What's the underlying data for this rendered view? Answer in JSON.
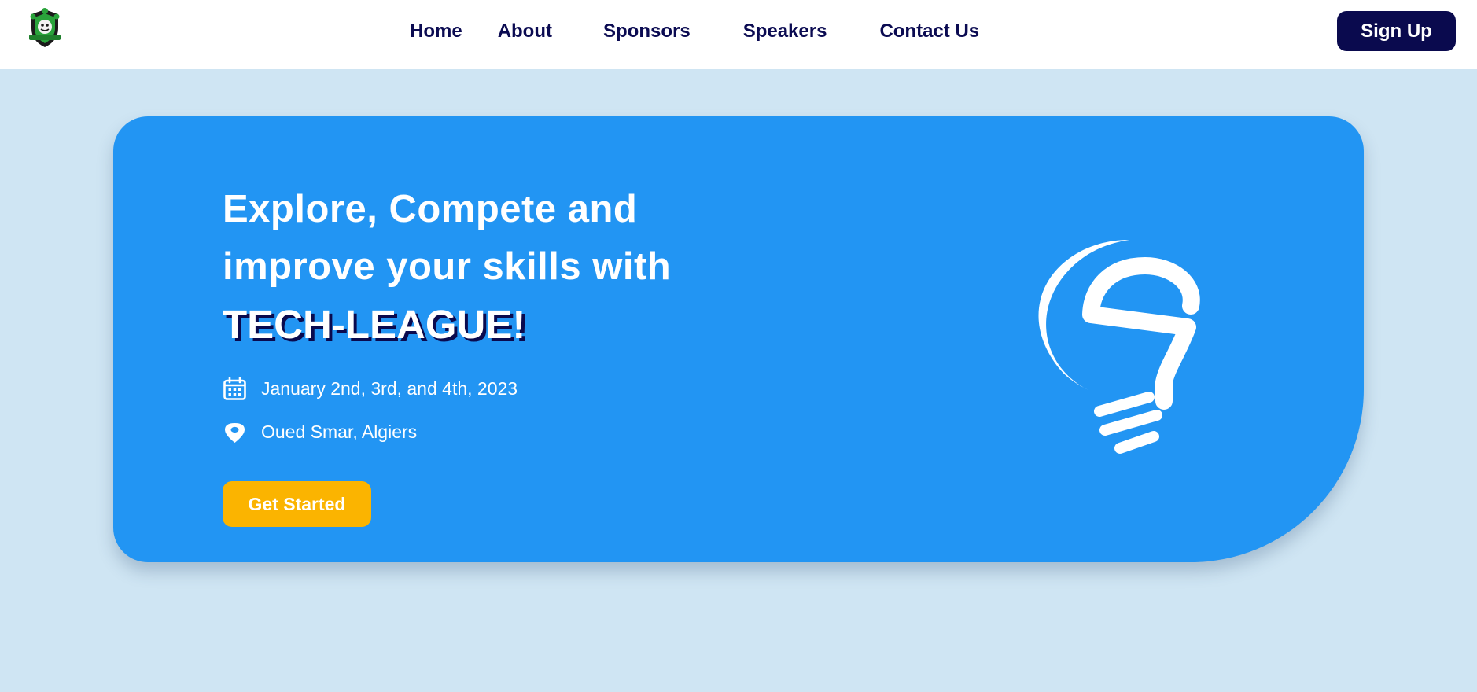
{
  "nav": {
    "logo_icon": "team-crest-logo",
    "links": [
      {
        "label": "Home"
      },
      {
        "label": "About"
      },
      {
        "label": "Sponsors"
      },
      {
        "label": "Speakers"
      },
      {
        "label": "Contact Us"
      }
    ],
    "signup_label": "Sign Up"
  },
  "hero": {
    "headline_line1": "Explore, Compete and",
    "headline_line2": "improve your skills with",
    "brand": "TECH-LEAGUE!",
    "date_icon": "calendar-icon",
    "date": "January 2nd, 3rd, and 4th, 2023",
    "location_icon": "location-pin-icon",
    "location": "Oued Smar, Algiers",
    "cta_label": "Get Started",
    "illustration": "lightbulb-icon"
  },
  "colors": {
    "page_bg": "#cfe5f3",
    "navbar_bg": "#ffffff",
    "nav_text": "#0b0b52",
    "primary_dark": "#0a0a4e",
    "hero_bg": "#2295f3",
    "cta_bg": "#fbb400",
    "text_light": "#ffffff"
  }
}
